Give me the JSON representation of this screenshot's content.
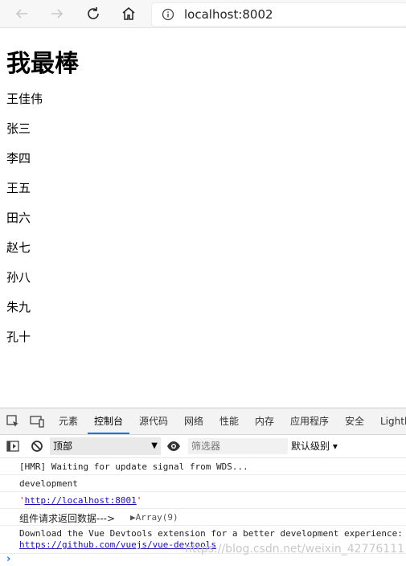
{
  "browser": {
    "url": "localhost:8002",
    "icons": [
      "back-icon",
      "forward-icon",
      "refresh-icon",
      "home-icon",
      "info-icon"
    ]
  },
  "page": {
    "title": "我最棒",
    "names": [
      "王佳伟",
      "张三",
      "李四",
      "王五",
      "田六",
      "赵七",
      "孙八",
      "朱九",
      "孔十"
    ]
  },
  "devtools": {
    "tabs": [
      "元素",
      "控制台",
      "源代码",
      "网络",
      "性能",
      "内存",
      "应用程序",
      "安全",
      "Lighth"
    ],
    "active_tab": "控制台",
    "context": "顶部",
    "filter_placeholder": "筛选器",
    "level": "默认级别 ▾",
    "logs": {
      "hmr": "[HMR] Waiting for update signal from WDS...",
      "env": "development",
      "url_quote_open": "'",
      "url": "http://localhost:8001",
      "url_quote_close": "'",
      "response_label": "组件请求返回数据--->",
      "array": "▶Array(9)",
      "devtools_msg": "Download the Vue Devtools extension for a better development experience:",
      "devtools_link": "https://github.com/vuejs/vue-devtools"
    },
    "prompt": "›",
    "watermark": "https://blog.csdn.net/weixin_42776111"
  }
}
